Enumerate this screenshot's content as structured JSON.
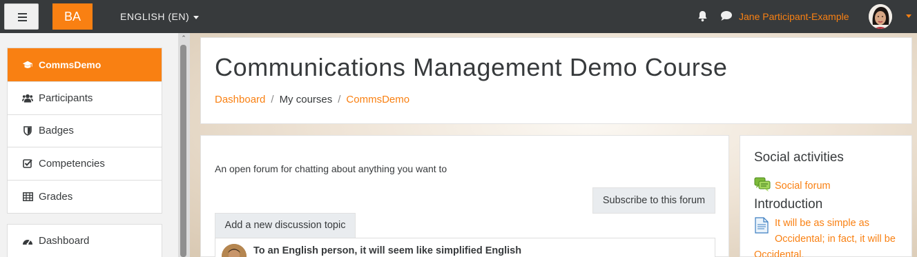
{
  "navbar": {
    "brand": "BA",
    "language": "ENGLISH (EN)",
    "user_name": "Jane Participant-Example",
    "colors": {
      "bar": "#373a3c",
      "accent": "#f98012"
    }
  },
  "drawer": {
    "course": "CommsDemo",
    "items": [
      {
        "label": "Participants",
        "icon": "users-icon"
      },
      {
        "label": "Badges",
        "icon": "shield-icon"
      },
      {
        "label": "Competencies",
        "icon": "checkbox-icon"
      },
      {
        "label": "Grades",
        "icon": "table-icon"
      }
    ],
    "dashboard": {
      "label": "Dashboard",
      "icon": "dashboard-icon"
    }
  },
  "header": {
    "title": "Communications Management Demo Course",
    "breadcrumb": [
      {
        "label": "Dashboard",
        "link": true
      },
      {
        "label": "My courses",
        "link": false
      },
      {
        "label": "CommsDemo",
        "link": true
      }
    ]
  },
  "forum": {
    "intro": "An open forum for chatting about anything you want to",
    "subscribe_label": "Subscribe to this forum",
    "add_topic_label": "Add a new discussion topic",
    "discussions": [
      {
        "subject": "To an English person, it will seem like simplified English"
      }
    ]
  },
  "social_block": {
    "title": "Social activities",
    "forum_link": "Social forum",
    "section": "Introduction",
    "file_link": "It will be as simple as Occidental; in fact, it will be Occidental."
  }
}
